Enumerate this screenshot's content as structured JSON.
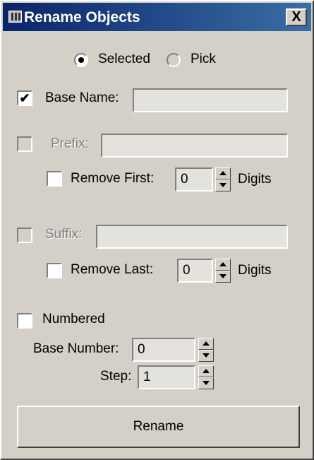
{
  "window": {
    "title": "Rename Objects",
    "close_label": "X"
  },
  "mode": {
    "selected_label": "Selected",
    "pick_label": "Pick",
    "value": "Selected"
  },
  "base_name": {
    "label": "Base Name:",
    "checked": true,
    "value": ""
  },
  "prefix": {
    "label": "Prefix:",
    "checked": false,
    "enabled": false,
    "value": ""
  },
  "remove_first": {
    "label": "Remove First:",
    "checked": false,
    "value": "0",
    "unit": "Digits"
  },
  "suffix": {
    "label": "Suffix:",
    "checked": false,
    "enabled": false,
    "value": ""
  },
  "remove_last": {
    "label": "Remove Last:",
    "checked": false,
    "value": "0",
    "unit": "Digits"
  },
  "numbered": {
    "label": "Numbered",
    "checked": false,
    "base_number_label": "Base Number:",
    "base_number": "0",
    "step_label": "Step:",
    "step": "1"
  },
  "actions": {
    "rename_label": "Rename"
  },
  "colors": {
    "titlebar_start": "#0a246a",
    "titlebar_end": "#3a6ea5",
    "face": "#d4d0c8",
    "disabled_text": "#808080"
  }
}
